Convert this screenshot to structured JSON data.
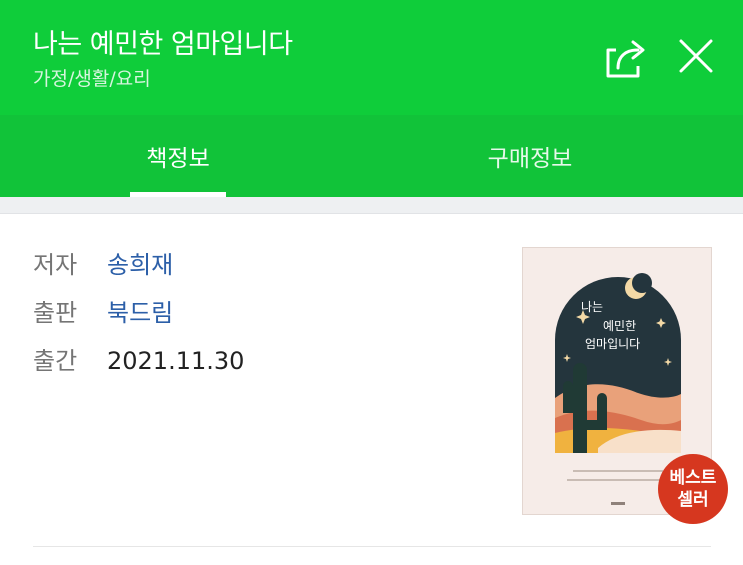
{
  "header": {
    "title": "나는 예민한 엄마입니다",
    "category": "가정/생활/요리",
    "share_icon": "share-icon",
    "close_icon": "close-icon",
    "bg_color": "#0fcd3a"
  },
  "tabs": [
    {
      "label": "책정보",
      "active": true
    },
    {
      "label": "구매정보",
      "active": false
    }
  ],
  "book": {
    "author_label": "저자",
    "author": "송희재",
    "publisher_label": "출판",
    "publisher": "북드림",
    "date_label": "출간",
    "date": "2021.11.30"
  },
  "badge": {
    "line1": "베스트",
    "line2": "셀러",
    "color": "#d6371f"
  },
  "cover": {
    "title_lines": [
      "나는",
      "예민한",
      "엄마입니다"
    ]
  }
}
